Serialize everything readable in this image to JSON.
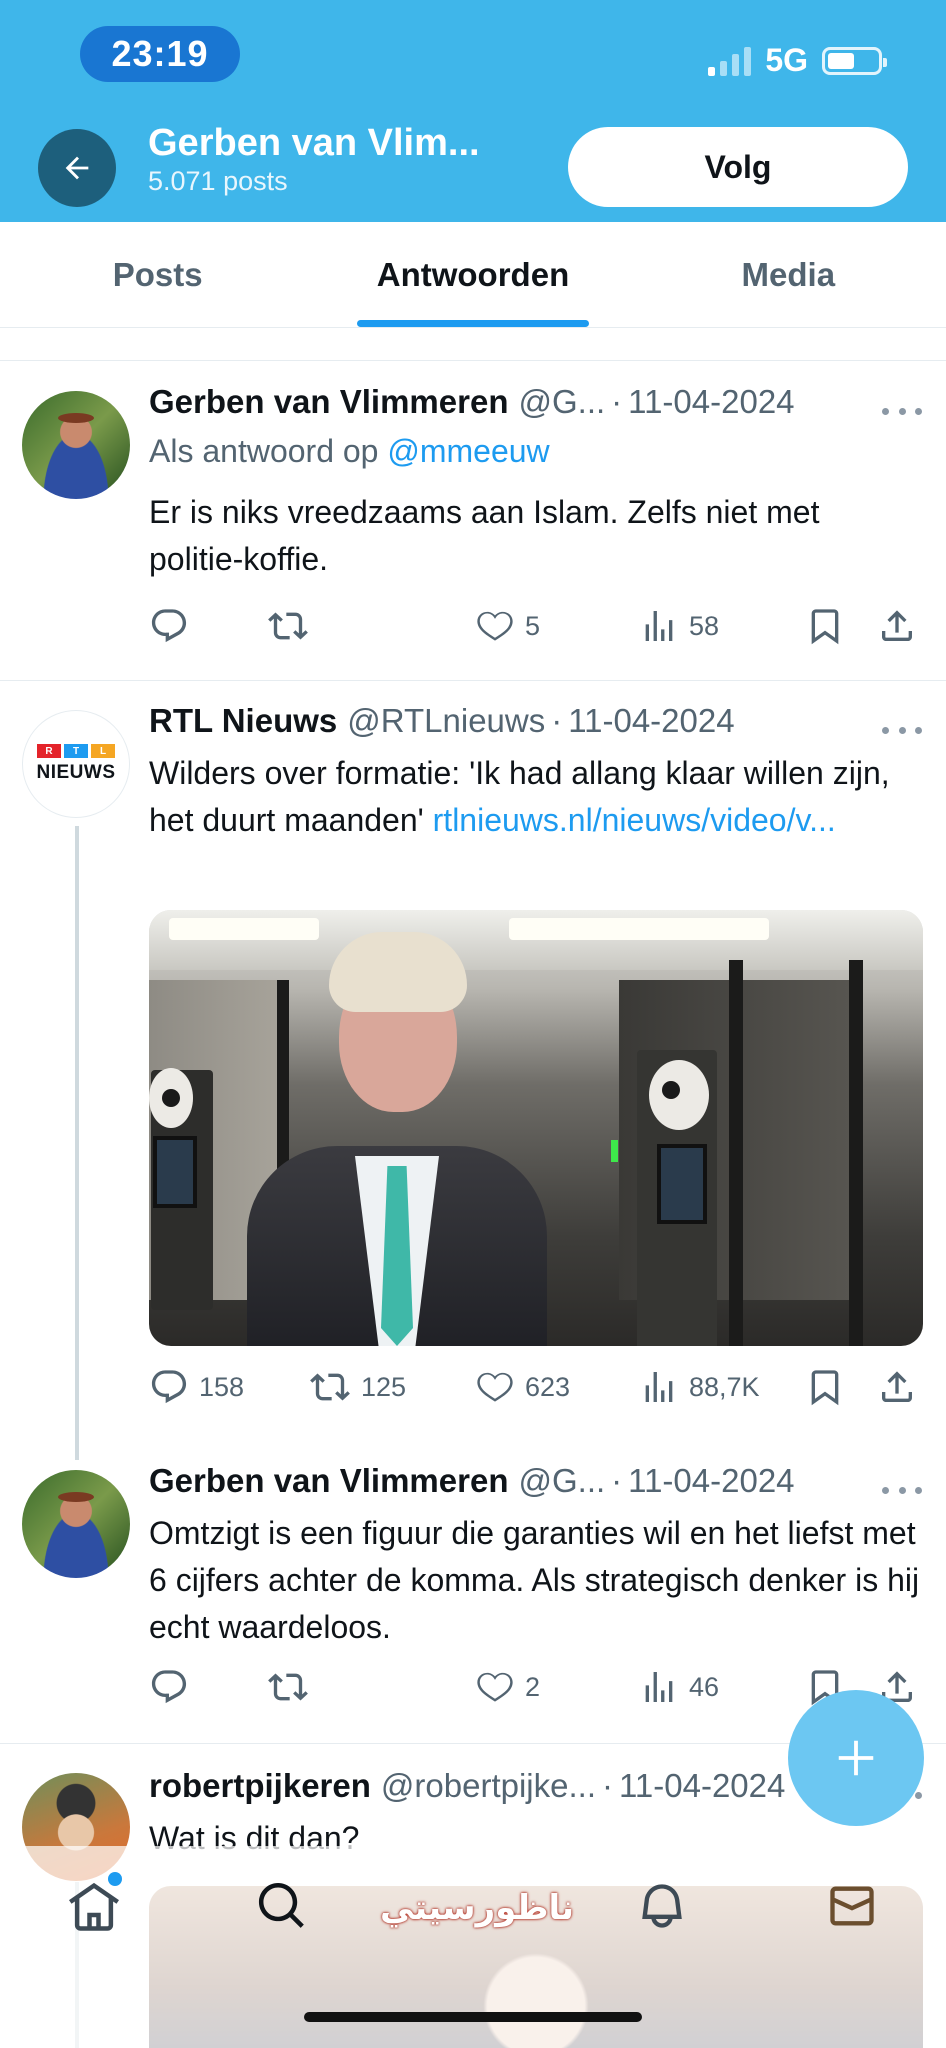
{
  "status_bar": {
    "time": "23:19",
    "network": "5G",
    "battery_level": 0.55
  },
  "header": {
    "title": "Gerben van Vlim...",
    "post_count": "5.071 posts",
    "follow_label": "Volg"
  },
  "tabs": [
    {
      "label": "Posts",
      "active": false
    },
    {
      "label": "Antwoorden",
      "active": true
    },
    {
      "label": "Media",
      "active": false
    }
  ],
  "posts": [
    {
      "name": "Gerben van Vlimmeren",
      "handle": "@G...",
      "date": "11-04-2024",
      "reply_prefix": "Als antwoord op",
      "reply_to": "@mmeeuw",
      "text": "Er is niks vreedzaams aan Islam. Zelfs niet met politie-koffie.",
      "stats": {
        "replies": "",
        "reposts": "",
        "likes": "5",
        "views": "58"
      }
    },
    {
      "name": "RTL Nieuws",
      "handle": "@RTLnieuws",
      "date": "11-04-2024",
      "avatar_text": "NIEUWS",
      "avatar_blocks": [
        "R",
        "T",
        "L"
      ],
      "text": "Wilders over formatie: 'Ik had allang klaar willen zijn, het duurt maanden'",
      "link": "rtlnieuws.nl/nieuws/video/v...",
      "stats": {
        "replies": "158",
        "reposts": "125",
        "likes": "623",
        "views": "88,7K"
      }
    },
    {
      "name": "Gerben van Vlimmeren",
      "handle": "@G...",
      "date": "11-04-2024",
      "text": "Omtzigt is een figuur die garanties wil en het liefst met 6 cijfers achter de komma. Als strategisch denker is hij echt waardeloos.",
      "stats": {
        "replies": "",
        "reposts": "",
        "likes": "2",
        "views": "46"
      }
    },
    {
      "name": "robertpijkeren",
      "handle": "@robertpijke...",
      "date": "11-04-2024",
      "text": "Wat is dit dan?"
    }
  ],
  "watermark": "ناظورسيتي",
  "colors": {
    "header_bg": "#3fb6ea",
    "accent": "#1d9bf0",
    "back_button": "#1d5f7c",
    "fab": "#6cc7f2"
  },
  "icons": [
    "back-arrow-icon",
    "reply-icon",
    "repost-icon",
    "like-icon",
    "views-icon",
    "bookmark-icon",
    "share-icon",
    "plus-icon",
    "home-icon",
    "search-icon",
    "bell-icon",
    "mail-icon"
  ]
}
